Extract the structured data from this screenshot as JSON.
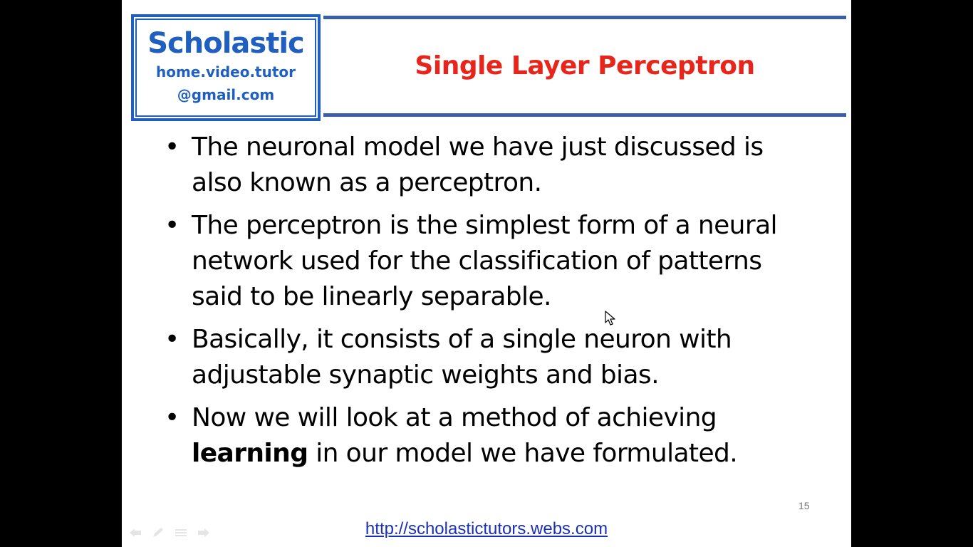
{
  "logo": {
    "name": "Scholastic",
    "email_line1": "home.video.tutor",
    "email_line2": "@gmail.com"
  },
  "slide": {
    "title": "Single Layer Perceptron",
    "bullets": [
      {
        "text": "The neuronal model we have just discussed is also known as a perceptron."
      },
      {
        "text": "The perceptron is the simplest form of a neural network used for the classification of patterns said to be linearly separable."
      },
      {
        "text": "Basically, it consists of a single neuron with adjustable synaptic weights and bias."
      },
      {
        "text_before": "Now we will look at a method of achieving ",
        "bold": "learning",
        "text_after": " in our model we have formulated."
      }
    ],
    "page_number": "15",
    "footer_link": "http://scholastictutors.webs.com"
  },
  "colors": {
    "title": "#e8251b",
    "logo": "#1f5fbf",
    "rule": "#3a5fa8",
    "link": "#1a2fb8"
  },
  "icons": {
    "bullet": "•",
    "nav_prev": "previous-arrow-icon",
    "nav_pen": "pen-icon",
    "nav_menu": "menu-icon",
    "nav_next": "next-arrow-icon",
    "cursor": "mouse-pointer-icon"
  }
}
